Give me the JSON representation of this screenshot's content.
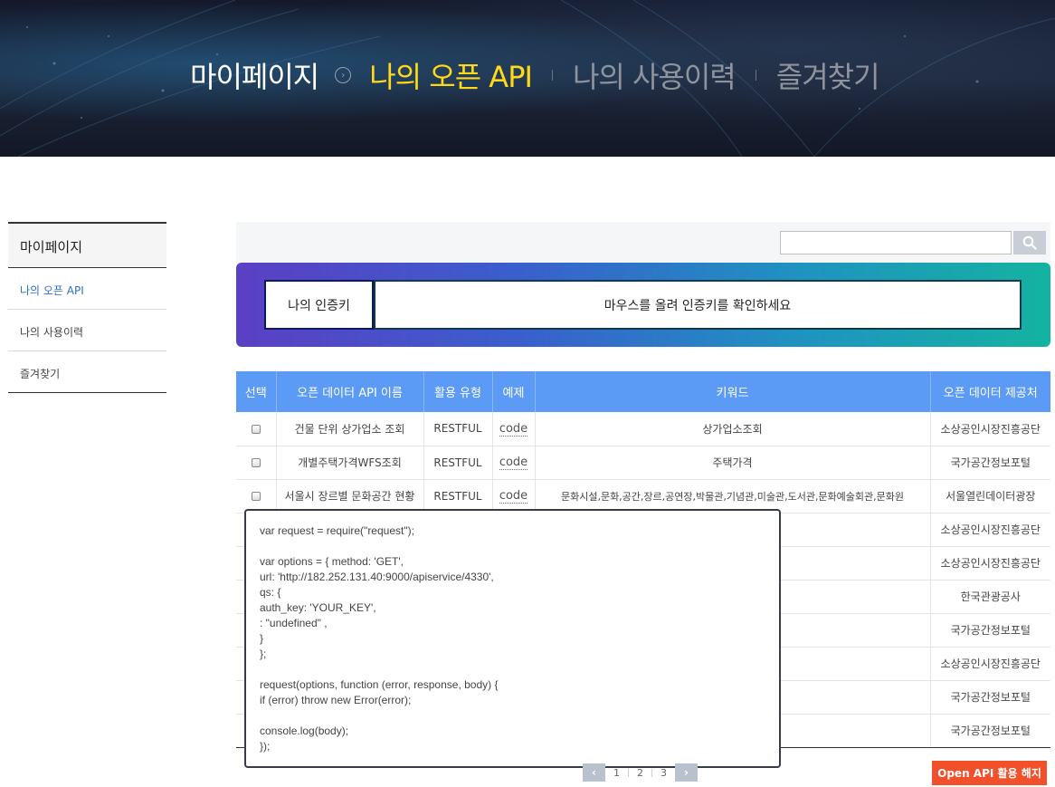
{
  "hero": {
    "home": "마이페이지",
    "tabs": [
      "나의 오픈 API",
      "나의 사용이력",
      "즐겨찾기"
    ],
    "active_index": 0
  },
  "sidebar": {
    "title": "마이페이지",
    "items": [
      {
        "label": "나의 오픈 API",
        "active": true
      },
      {
        "label": "나의 사용이력",
        "active": false
      },
      {
        "label": "즐겨찾기",
        "active": false
      }
    ]
  },
  "search": {
    "value": "",
    "placeholder": ""
  },
  "auth_key": {
    "label": "나의 인증키",
    "hint": "마우스를 올려 인증키를 확인하세요"
  },
  "table": {
    "headers": [
      "선택",
      "오픈 데이터 API 이름",
      "활용 유형",
      "예제",
      "키워드",
      "오픈 데이터 제공처"
    ],
    "rows": [
      {
        "name": "건물 단위 상가업소 조회",
        "type": "RESTFUL",
        "example": "code",
        "keyword": "상가업소조회",
        "provider": "소상공인시장진흥공단"
      },
      {
        "name": "개별주택가격WFS조회",
        "type": "RESTFUL",
        "example": "code",
        "keyword": "주택가격",
        "provider": "국가공간정보포털"
      },
      {
        "name": "서울시 장르별 문화공간 현황",
        "type": "RESTFUL",
        "example": "code",
        "keyword": "문화시설,문화,공간,장르,공연장,박물관,기념관,미술관,도서관,문화예술회관,문화원",
        "provider": "서울열린데이터광장"
      },
      {
        "name": "",
        "type": "",
        "example": "",
        "keyword": "",
        "provider": "소상공인시장진흥공단"
      },
      {
        "name": "",
        "type": "",
        "example": "",
        "keyword": "",
        "provider": "소상공인시장진흥공단"
      },
      {
        "name": "",
        "type": "",
        "example": "",
        "keyword": "",
        "provider": "한국관광공사"
      },
      {
        "name": "",
        "type": "",
        "example": "",
        "keyword": "",
        "provider": "국가공간정보포털"
      },
      {
        "name": "",
        "type": "",
        "example": "",
        "keyword": "",
        "provider": "소상공인시장진흥공단"
      },
      {
        "name": "",
        "type": "",
        "example": "",
        "keyword": "",
        "provider": "국가공간정보포털"
      },
      {
        "name": "",
        "type": "",
        "example": "",
        "keyword": "",
        "provider": "국가공간정보포털"
      }
    ]
  },
  "code_popup": {
    "lines": [
      "var request = require(\"request\");",
      "",
      "var options = { method: 'GET',",
      "url: 'http://182.252.131.40:9000/apiservice/4330',",
      "qs: {",
      "auth_key: 'YOUR_KEY',",
      ": \"undefined\" ,",
      "}",
      "};",
      "",
      "request(options, function (error, response, body) {",
      "if (error) throw new Error(error);",
      "",
      "console.log(body);",
      "});"
    ]
  },
  "pagination": {
    "prev": "‹",
    "next": "›",
    "pages": [
      "1",
      "2",
      "3"
    ]
  },
  "actions": {
    "terminate_label": "Open API 활용 해지"
  },
  "colors": {
    "accent_yellow": "#ffd918",
    "table_header": "#5b9bf5",
    "terminate": "#f1502a"
  }
}
